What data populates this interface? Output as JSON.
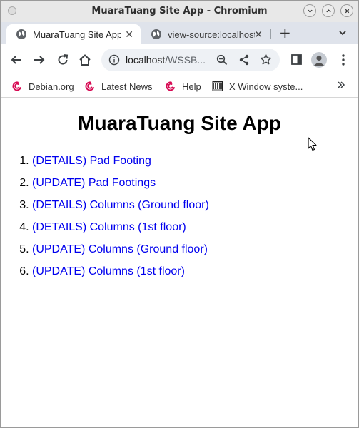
{
  "window": {
    "title": "MuaraTuang Site App - Chromium"
  },
  "tabs": [
    {
      "label": "MuaraTuang Site App",
      "active": true,
      "icon": "globe-icon"
    },
    {
      "label": "view-source:localhost",
      "active": false,
      "icon": "globe-icon"
    }
  ],
  "toolbar": {
    "url_host": "localhost",
    "url_path": "/WSSB..."
  },
  "bookmarks": [
    {
      "label": "Debian.org",
      "icon": "debian-swirl-icon"
    },
    {
      "label": "Latest News",
      "icon": "debian-swirl-icon"
    },
    {
      "label": "Help",
      "icon": "debian-swirl-icon"
    },
    {
      "label": "X Window syste...",
      "icon": "x-window-icon"
    }
  ],
  "page": {
    "heading": "MuaraTuang Site App",
    "links": [
      "(DETAILS) Pad Footing",
      "(UPDATE) Pad Footings",
      "(DETAILS) Columns (Ground floor)",
      "(DETAILS) Columns (1st floor)",
      "(UPDATE) Columns (Ground floor)",
      "(UPDATE) Columns (1st floor)"
    ]
  },
  "colors": {
    "link": "#0000ee",
    "tabstrip": "#dfe3eb",
    "omnibox": "#eef1f5",
    "debian_red": "#d70a53"
  }
}
